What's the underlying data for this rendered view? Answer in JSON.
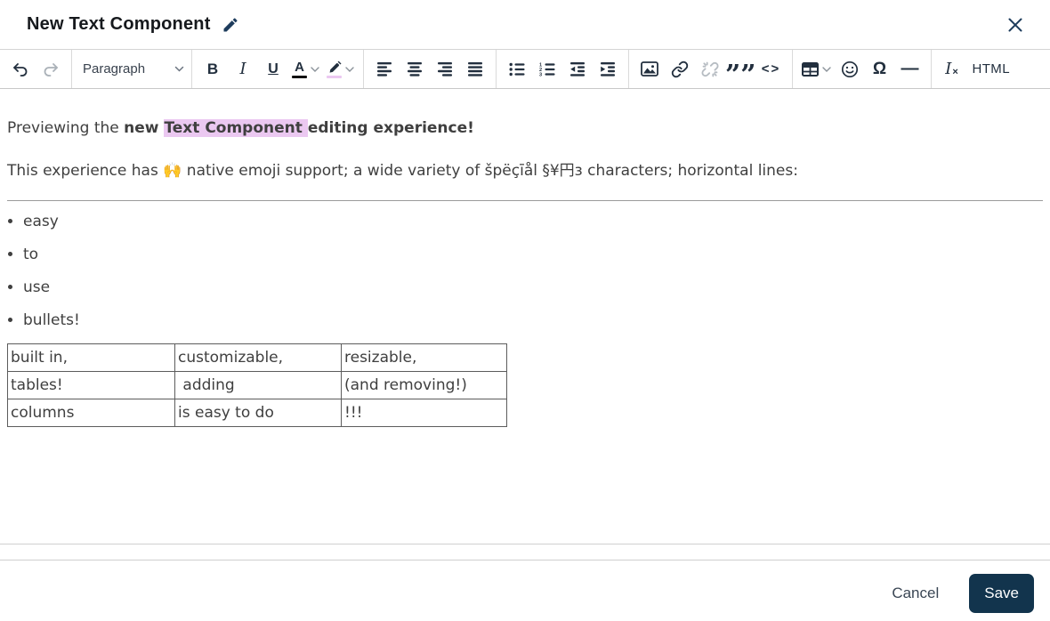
{
  "header": {
    "title": "New Text Component"
  },
  "toolbar": {
    "paragraph_label": "Paragraph",
    "bold_glyph": "B",
    "italic_glyph": "I",
    "underline_glyph": "U",
    "text_color_letter": "A",
    "text_color_swatch_style": "background:#111111",
    "highlight_swatch_style": "background:#ebc8f1",
    "quote_glyph": "””",
    "code_glyph": "<>",
    "omega_glyph": "Ω",
    "hr_glyph": "—",
    "clear_format_letter": "I",
    "clear_format_sub": "×",
    "html_label": "HTML",
    "buttons": [
      "undo",
      "redo",
      "paragraph-style",
      "bold",
      "italic",
      "underline",
      "text-color",
      "highlight-color",
      "align-left",
      "align-center",
      "align-right",
      "align-justify",
      "bullet-list",
      "numbered-list",
      "outdent",
      "indent",
      "insert-image",
      "insert-link",
      "remove-link",
      "blockquote",
      "code",
      "insert-table",
      "emoji",
      "special-character",
      "horizontal-rule",
      "clear-formatting",
      "html"
    ],
    "disabled_buttons": [
      "redo",
      "remove-link"
    ]
  },
  "content": {
    "p1": {
      "seg1": "Previewing the ",
      "seg2": "new ",
      "seg3": "Text Component ",
      "seg4": "editing experience!"
    },
    "highlight_style": "background:#ebc8f1",
    "p2": "This experience has 🙌 native emoji support; a wide variety of špëçīål §¥円ɜ characters; horizontal lines:",
    "bullets": [
      "easy",
      "to",
      "use",
      "bullets!"
    ],
    "table": {
      "rows": [
        [
          "built in,",
          "customizable,",
          "resizable,"
        ],
        [
          "tables!",
          " adding",
          "(and removing!)"
        ],
        [
          "columns",
          "is easy to do",
          "!!!"
        ]
      ]
    }
  },
  "footer": {
    "cancel_label": "Cancel",
    "save_label": "Save"
  },
  "colors": {
    "accent_navy": "#12344d",
    "icon": "#222f3e",
    "highlight_pink": "#ebc8f1",
    "body_text": "#3f3f3f"
  }
}
